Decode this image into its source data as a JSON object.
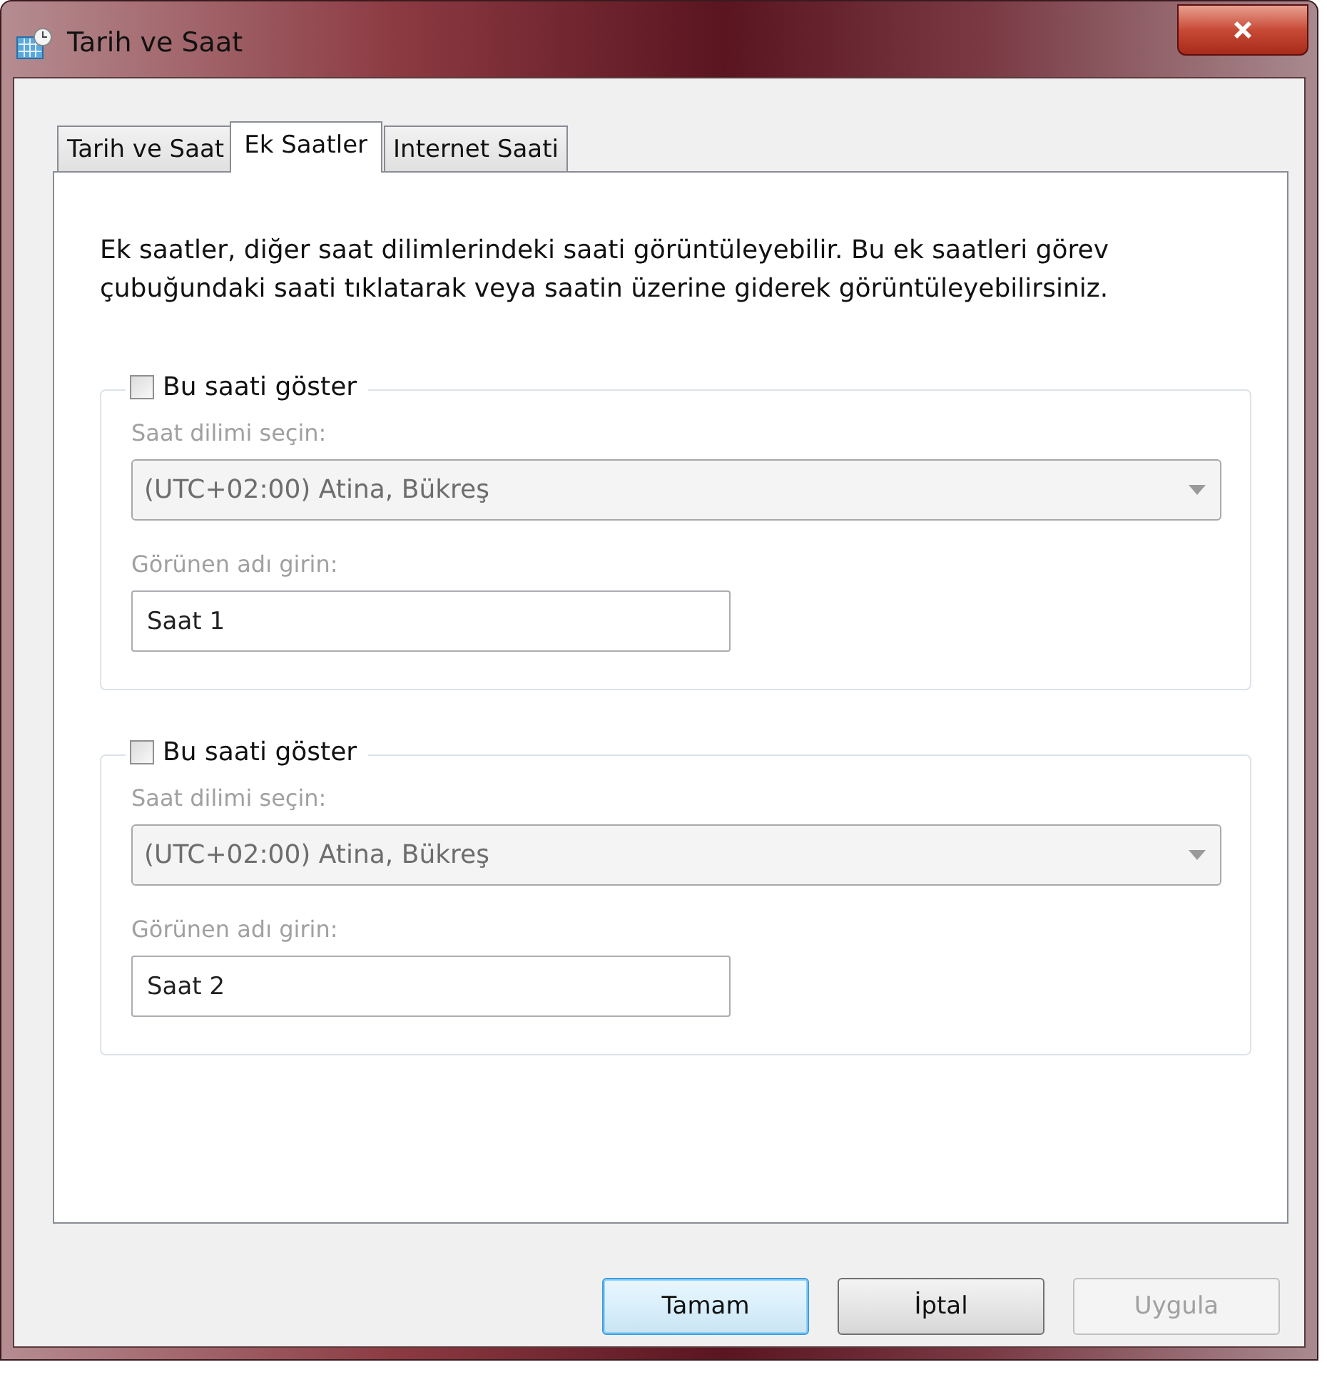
{
  "window": {
    "title": "Tarih ve Saat"
  },
  "tabs": [
    {
      "label": "Tarih ve Saat",
      "selected": false
    },
    {
      "label": "Ek Saatler",
      "selected": true
    },
    {
      "label": "Internet Saati",
      "selected": false
    }
  ],
  "description": "Ek saatler, diğer saat dilimlerindeki saati görüntüleyebilir. Bu ek saatleri görev çubuğundaki saati tıklatarak veya saatin üzerine giderek görüntüleyebilirsiniz.",
  "clocks": [
    {
      "show_label": "Bu saati göster",
      "checked": false,
      "timezone_label": "Saat dilimi seçin:",
      "timezone": "(UTC+02:00) Atina, Bükreş",
      "name_label": "Görünen adı girin:",
      "name": "Saat 1"
    },
    {
      "show_label": "Bu saati göster",
      "checked": false,
      "timezone_label": "Saat dilimi seçin:",
      "timezone": "(UTC+02:00) Atina, Bükreş",
      "name_label": "Görünen adı girin:",
      "name": "Saat 2"
    }
  ],
  "buttons": [
    {
      "label": "Tamam",
      "default": true,
      "disabled": false
    },
    {
      "label": "İptal",
      "default": false,
      "disabled": false
    },
    {
      "label": "Uygula",
      "default": false,
      "disabled": true
    }
  ]
}
